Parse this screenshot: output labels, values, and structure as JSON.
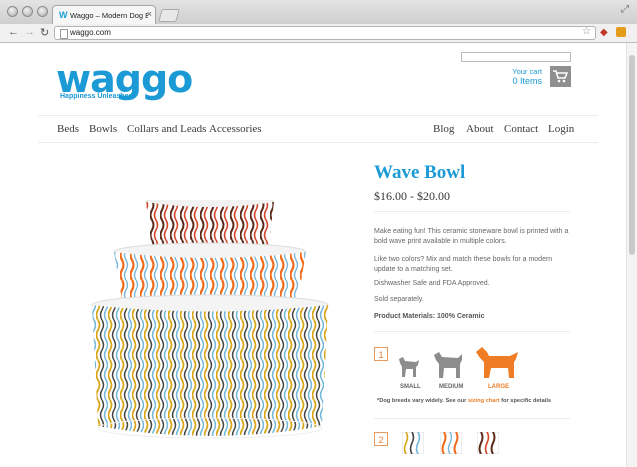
{
  "browser": {
    "tab_logo": "W",
    "tab_title": "Waggo – Modern Dog Bowls",
    "tab_close": "×",
    "url": "waggo.com"
  },
  "site": {
    "logo_text": "waggo",
    "tagline": "Happiness Unleashed",
    "cart_label": "Your cart",
    "cart_count": "0 Items"
  },
  "nav_left": [
    "Beds",
    "Bowls",
    "Collars and Leads",
    "Accessories"
  ],
  "nav_right": [
    "Blog",
    "About",
    "Contact",
    "Login"
  ],
  "product": {
    "title": "Wave Bowl",
    "price": "$16.00 - $20.00",
    "desc1": "Make eating fun! This ceramic stoneware bowl is printed with a bold wave print available in multiple colors.",
    "desc2": "Like two colors? Mix and match these bowls for a modern update to a matching set.",
    "desc3": "Dishwasher Safe and FDA Approved.",
    "desc4": "Sold separately.",
    "materials": "Product Materials: 100% Ceramic"
  },
  "step1": {
    "number": "1",
    "sizes": [
      {
        "label": "SMALL",
        "selected": false
      },
      {
        "label": "MEDIUM",
        "selected": false
      },
      {
        "label": "LARGE",
        "selected": true
      }
    ],
    "note_pre": "*Dog breeds vary widely. See our ",
    "note_link": "sizing chart",
    "note_post": " for specific details"
  },
  "step2": {
    "number": "2",
    "swatches": [
      "multi-blue",
      "orange",
      "brown"
    ]
  },
  "colors": {
    "brand_blue": "#1b9ad6",
    "accent_orange": "#ee7d25",
    "text_grey": "#666666"
  }
}
